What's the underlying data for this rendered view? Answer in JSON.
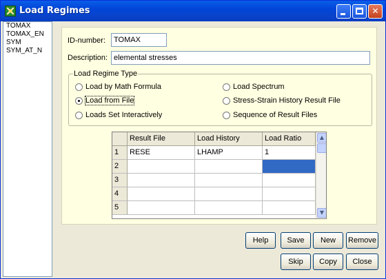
{
  "window": {
    "title": "Load Regimes",
    "icon": "app-icon",
    "controls": [
      "minimize-icon",
      "maximize-icon",
      "close-icon"
    ]
  },
  "left_list": {
    "items": [
      "TOMAX",
      "TOMAX_EN",
      "SYM",
      "SYM_AT_N"
    ]
  },
  "form": {
    "id_label": "ID-number:",
    "id_value": "TOMAX",
    "description_label": "Description:",
    "description_value": "elemental stresses"
  },
  "load_regime_type": {
    "title": "Load Regime Type",
    "options": [
      {
        "label": "Load by Math Formula",
        "checked": false
      },
      {
        "label": "Load from File",
        "checked": true
      },
      {
        "label": "Loads Set Interactively",
        "checked": false
      },
      {
        "label": "Load Spectrum",
        "checked": false
      },
      {
        "label": "Stress-Strain History Result File",
        "checked": false
      },
      {
        "label": "Sequence of Result Files",
        "checked": false
      }
    ]
  },
  "table": {
    "headers": [
      "Result File",
      "Load History",
      "Load Ratio"
    ],
    "rows": [
      {
        "n": "1",
        "cells": [
          "RESE",
          "LHAMP",
          "1"
        ]
      },
      {
        "n": "2",
        "cells": [
          "",
          "",
          ""
        ]
      },
      {
        "n": "3",
        "cells": [
          "",
          "",
          ""
        ]
      },
      {
        "n": "4",
        "cells": [
          "",
          "",
          ""
        ]
      },
      {
        "n": "5",
        "cells": [
          "",
          "",
          ""
        ]
      }
    ],
    "selected_cell": {
      "row": 2,
      "col": 3
    }
  },
  "buttons": {
    "help": "Help",
    "save": "Save",
    "new": "New",
    "remove": "Remove",
    "skip": "Skip",
    "copy": "Copy",
    "close": "Close"
  }
}
